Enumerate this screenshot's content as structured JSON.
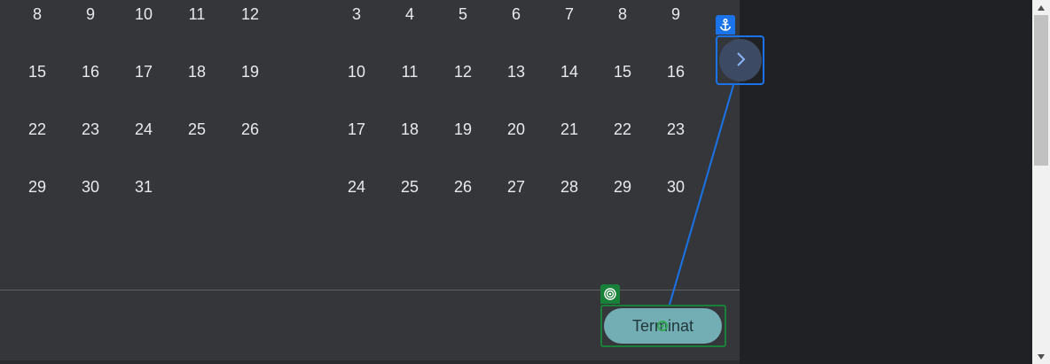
{
  "calendar": {
    "month_left": {
      "weeks": [
        [
          "8",
          "9",
          "10",
          "11",
          "12"
        ],
        [
          "15",
          "16",
          "17",
          "18",
          "19"
        ],
        [
          "22",
          "23",
          "24",
          "25",
          "26"
        ],
        [
          "29",
          "30",
          "31"
        ]
      ]
    },
    "month_right": {
      "weeks": [
        [
          "3",
          "4",
          "5",
          "6",
          "7",
          "8",
          "9"
        ],
        [
          "10",
          "11",
          "12",
          "13",
          "14",
          "15",
          "16"
        ],
        [
          "17",
          "18",
          "19",
          "20",
          "21",
          "22",
          "23"
        ],
        [
          "24",
          "25",
          "26",
          "27",
          "28",
          "29",
          "30"
        ]
      ]
    }
  },
  "footer": {
    "done_label": "Terminat"
  },
  "navigation": {
    "next_icon": "chevron-right-icon"
  },
  "annotations": {
    "source_icon": "anchor-icon",
    "target_icon": "target-icon",
    "source_color": "#1a73e8",
    "target_color": "#188038"
  },
  "colors": {
    "panel_bg": "#35363a",
    "page_bg": "#202124",
    "day_text": "#e8eaed",
    "button_bg": "#73aeb5",
    "next_button_bg": "#3c4a63"
  }
}
